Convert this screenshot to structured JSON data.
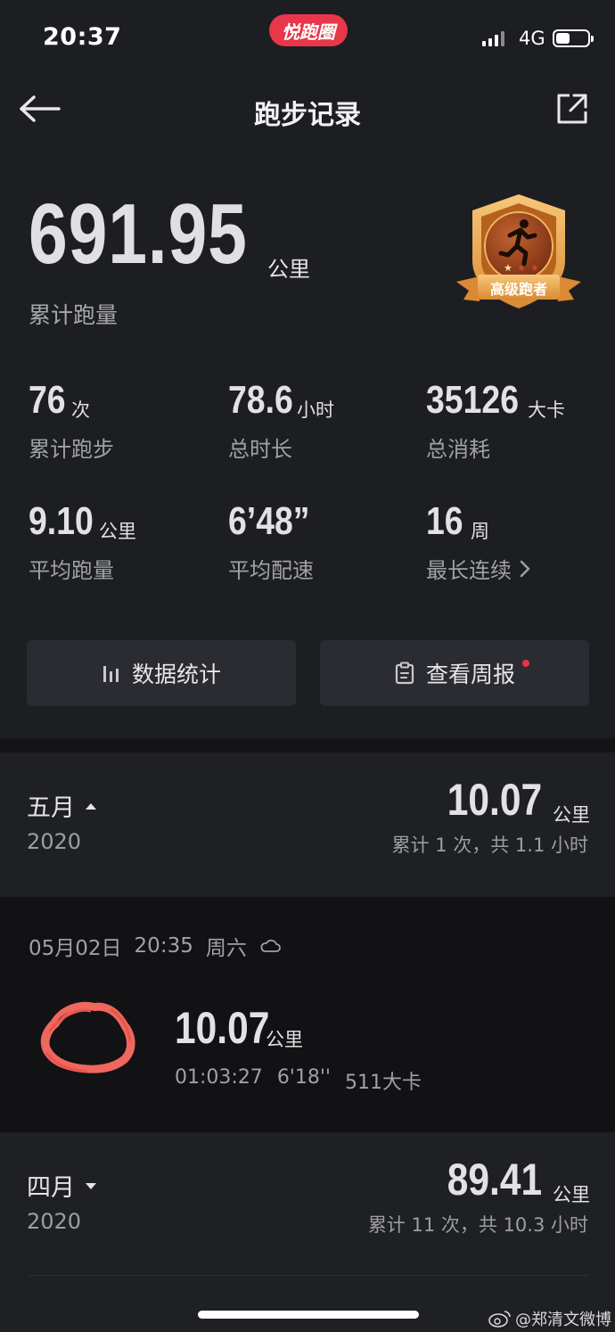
{
  "status_bar": {
    "time": "20:37",
    "brand": "悦跑圈",
    "network": "4G",
    "battery_level_percent": 45
  },
  "nav": {
    "title": "跑步记录",
    "back_icon": "arrow-left-icon",
    "share_icon": "share-icon"
  },
  "summary": {
    "total_distance": "691.95",
    "total_unit": "公里",
    "total_label": "累计跑量",
    "badge_text": "高级跑者"
  },
  "stats": [
    {
      "value": "76",
      "unit": "次",
      "label": "累计跑步"
    },
    {
      "value": "78.6",
      "unit": "小时",
      "label": "总时长"
    },
    {
      "value": "35126",
      "unit": "大卡",
      "label": "总消耗"
    },
    {
      "value": "9.10",
      "unit": "公里",
      "label": "平均跑量"
    },
    {
      "value": "6’48”",
      "unit": "",
      "label": "平均配速"
    },
    {
      "value": "16",
      "unit": "周",
      "label": "最长连续"
    }
  ],
  "buttons": {
    "data_stats": "数据统计",
    "weekly_report": "查看周报"
  },
  "months": [
    {
      "name": "五月",
      "year": "2020",
      "distance": "10.07",
      "unit": "公里",
      "summary": "累计 1 次，共 1.1 小时",
      "expanded": true
    },
    {
      "name": "四月",
      "year": "2020",
      "distance": "89.41",
      "unit": "公里",
      "summary": "累计 11 次，共 10.3 小时",
      "expanded": false
    }
  ],
  "run": {
    "date": "05月02日",
    "time": "20:35",
    "weekday": "周六",
    "weather_icon": "cloud-icon",
    "distance": "10.07",
    "unit": "公里",
    "duration": "01:03:27",
    "pace": "6'18''",
    "calories": "511大卡",
    "route_color": "#f0675e"
  },
  "watermark": "@郑清文微博",
  "colors": {
    "background": "#1d1e22",
    "accent_red": "#ee3344",
    "badge_gold": "#e8a34a",
    "badge_brown": "#8a3b1d"
  }
}
